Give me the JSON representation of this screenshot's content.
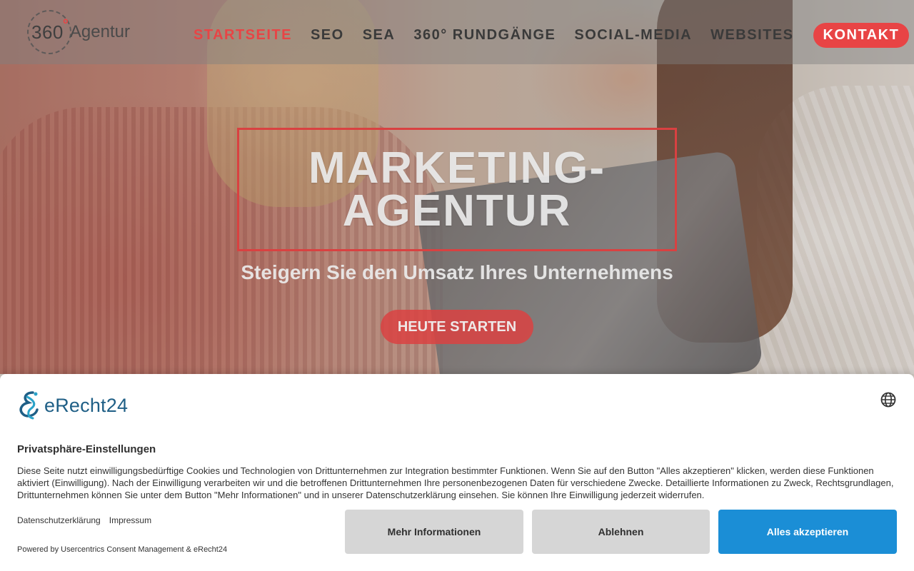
{
  "header": {
    "logo": {
      "number": "360",
      "degree": "°",
      "word": "Agentur"
    },
    "nav": [
      {
        "label": "STARTSEITE",
        "active": true
      },
      {
        "label": "SEO",
        "active": false
      },
      {
        "label": "SEA",
        "active": false
      },
      {
        "label": "360° RUNDGÄNGE",
        "active": false
      },
      {
        "label": "SOCIAL-MEDIA",
        "active": false
      },
      {
        "label": "WEBSITES",
        "active": false
      }
    ],
    "contact_label": "KONTAKT"
  },
  "hero": {
    "headline_line1": "MARKETING-",
    "headline_line2": "AGENTUR",
    "subheadline": "Steigern Sie den Umsatz Ihres Unternehmens",
    "cta_label": "HEUTE STARTEN"
  },
  "consent": {
    "brand": "eRecht24",
    "title": "Privatsphäre-Einstellungen",
    "body": "Diese Seite nutzt einwilligungsbedürftige Cookies und Technologien von Drittunternehmen zur Integration bestimmter Funktionen. Wenn Sie auf den Button \"Alles akzeptieren\" klicken, werden diese Funktionen aktiviert (Einwilligung). Nach der Einwilligung verarbeiten wir und die betroffenen Drittunternehmen Ihre personenbezogenen Daten für verschiedene Zwecke. Detaillierte Informationen zu Zweck, Rechtsgrundlagen, Drittunternehmen können Sie unter dem Button \"Mehr Informationen\" und in unserer Datenschutzerklärung einsehen. Sie können Ihre Einwilligung jederzeit widerrufen.",
    "links": [
      "Datenschutzerklärung",
      "Impressum"
    ],
    "powered_by": "Powered by Usercentrics Consent Management & eRecht24",
    "buttons": {
      "more": "Mehr Informationen",
      "decline": "Ablehnen",
      "accept": "Alles akzeptieren"
    },
    "language_icon": "globe-icon"
  },
  "colors": {
    "accent_red": "#e84445",
    "accept_blue": "#1b8ed6",
    "brand_teal": "#1f5f86"
  }
}
